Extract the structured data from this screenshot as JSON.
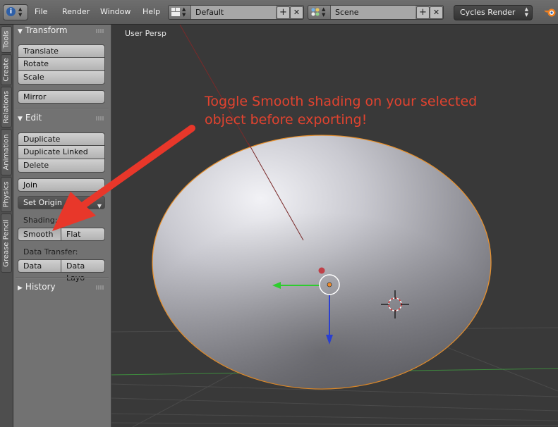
{
  "header": {
    "menus": [
      "File",
      "Render",
      "Window",
      "Help"
    ],
    "screen_layout": "Default",
    "scene": "Scene",
    "render_engine": "Cycles Render"
  },
  "tabs": [
    "Tools",
    "Create",
    "Relations",
    "Animation",
    "Physics",
    "Grease Pencil"
  ],
  "toolshelf": {
    "transform": {
      "title": "Transform",
      "translate": "Translate",
      "rotate": "Rotate",
      "scale": "Scale",
      "mirror": "Mirror"
    },
    "edit": {
      "title": "Edit",
      "duplicate": "Duplicate",
      "duplicate_linked": "Duplicate Linked",
      "delete": "Delete",
      "join": "Join",
      "set_origin": "Set Origin",
      "shading_label": "Shading:",
      "smooth": "Smooth",
      "flat": "Flat",
      "data_transfer_label": "Data Transfer:",
      "data": "Data",
      "data_layout": "Data Layo"
    },
    "history": {
      "title": "History"
    }
  },
  "viewport": {
    "view_label": "User Persp",
    "annotation": "Toggle Smooth shading on your selected object before exporting!"
  },
  "colors": {
    "annotation": "#e2432f",
    "header_bg": "#6e6e6e",
    "toolshelf_bg": "#727272",
    "viewport_bg": "#393939",
    "selection_outline": "#e8912e"
  },
  "icons": [
    "info-icon",
    "screen-layout-icon",
    "scene-icon",
    "add-icon",
    "close-icon",
    "blender-logo-icon",
    "collapse-triangle-icon",
    "expand-triangle-icon",
    "origin-dot-icon",
    "3d-cursor-icon",
    "manipulator-arrow-icon"
  ]
}
